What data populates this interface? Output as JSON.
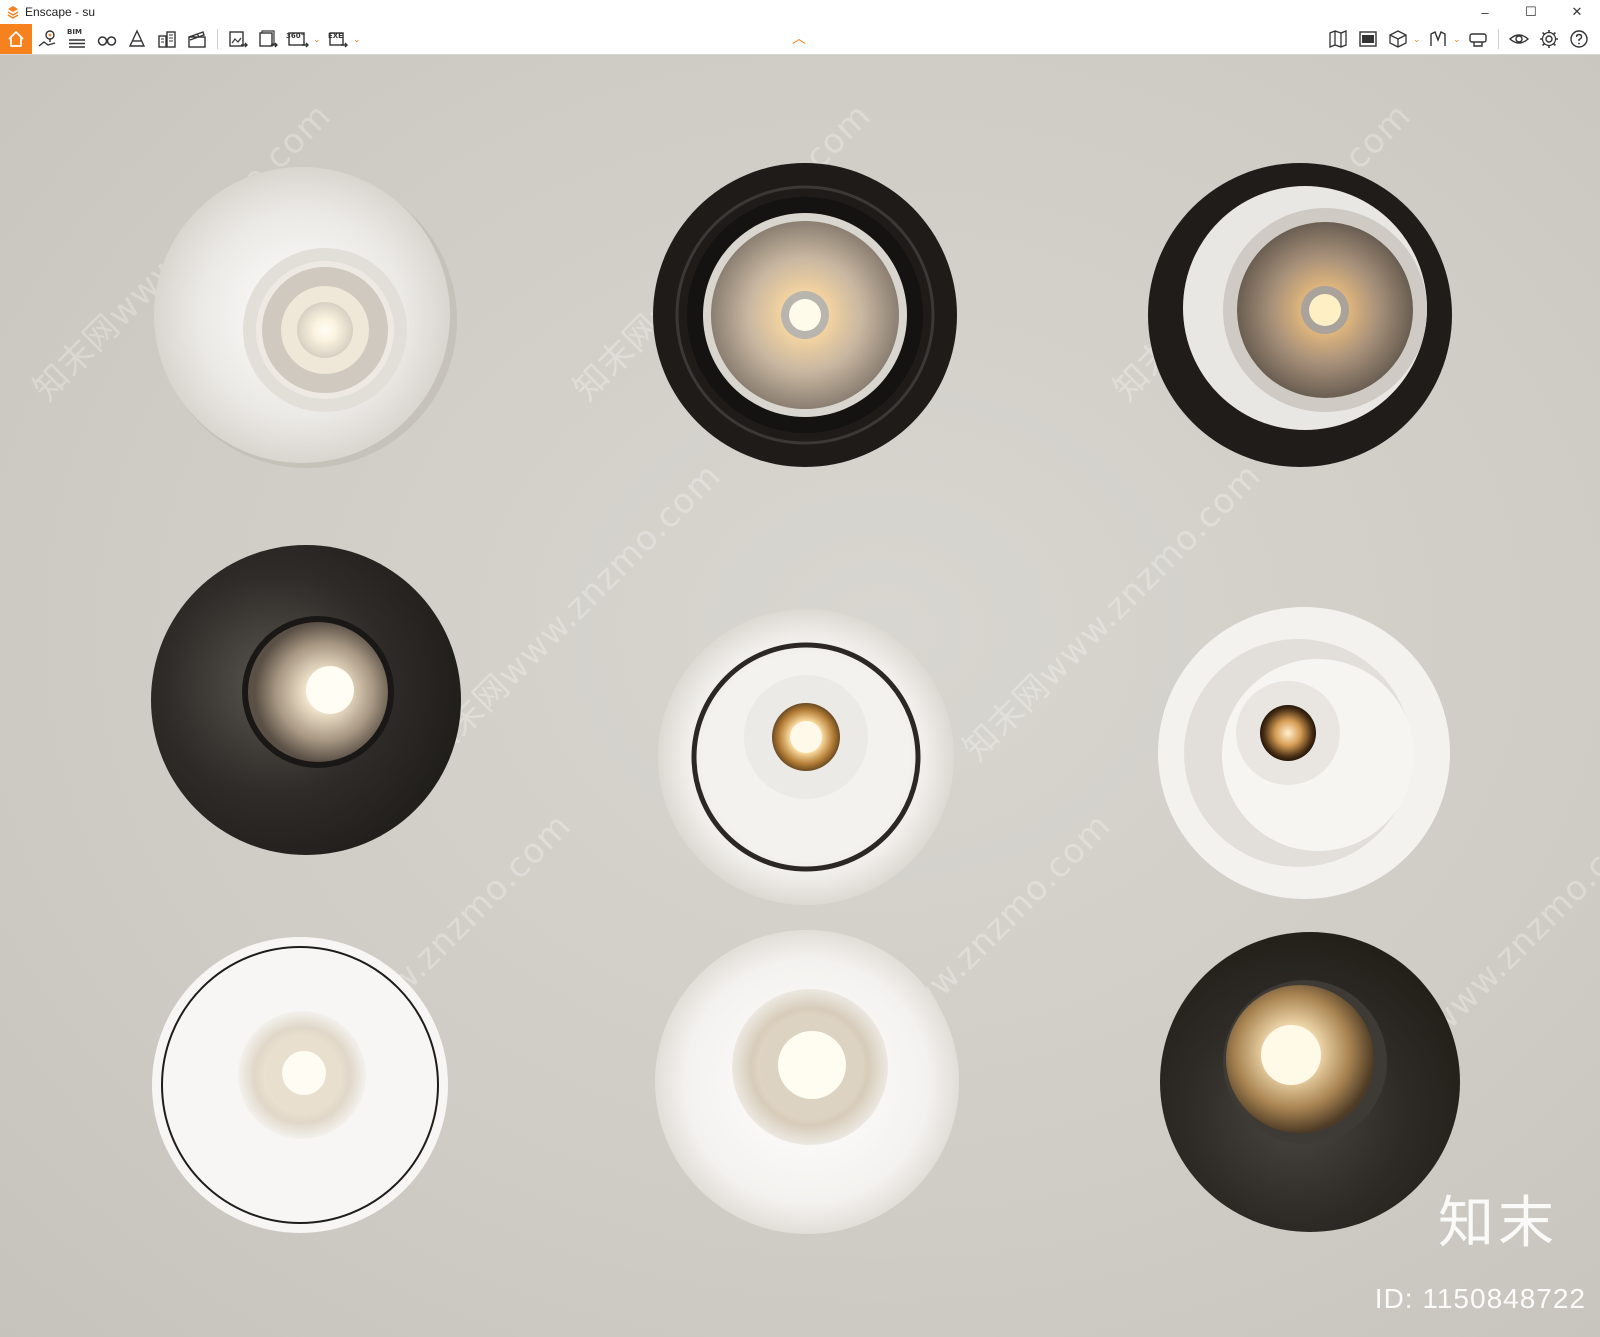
{
  "window": {
    "title": "Enscape - su",
    "controls": {
      "minimize": "–",
      "maximize": "☐",
      "close": "✕"
    }
  },
  "toolbar": {
    "left_tools": [
      {
        "name": "home-button",
        "icon": "home-icon"
      },
      {
        "name": "views-button",
        "icon": "location-pin-icon"
      },
      {
        "name": "bim-button",
        "icon": "bim-icon",
        "label": "BIM"
      },
      {
        "name": "walk-mode-button",
        "icon": "binoculars-icon"
      },
      {
        "name": "asset-library-button",
        "icon": "cone-icon"
      },
      {
        "name": "buildings-button",
        "icon": "buildings-icon"
      },
      {
        "name": "video-editor-button",
        "icon": "clapper-icon"
      },
      {
        "name": "screenshot-button",
        "icon": "export-image-icon"
      },
      {
        "name": "batch-render-button",
        "icon": "batch-export-icon"
      },
      {
        "name": "panorama-button",
        "icon": "panorama-icon",
        "label": "360°"
      },
      {
        "name": "exe-export-button",
        "icon": "exe-export-icon",
        "label": "EXE"
      }
    ],
    "right_tools": [
      {
        "name": "map-button",
        "icon": "map-icon"
      },
      {
        "name": "capture-button",
        "icon": "image-icon"
      },
      {
        "name": "cube-button",
        "icon": "cube-icon"
      },
      {
        "name": "materials-button",
        "icon": "materials-icon"
      },
      {
        "name": "vr-button",
        "icon": "vr-headset-icon"
      },
      {
        "name": "visual-settings-button",
        "icon": "eye-icon"
      },
      {
        "name": "settings-button",
        "icon": "gear-icon"
      },
      {
        "name": "help-button",
        "icon": "help-icon"
      }
    ],
    "accent_color": "#f5811f"
  },
  "viewport": {
    "watermark_text": "知末网www.znzmo.com",
    "brand_logo": "知末",
    "brand_id": "ID: 1150848722",
    "lights": [
      {
        "name": "light-white-trimmed",
        "housing": "#f2f1ee",
        "inner": "#e7e4df",
        "lens": "clear"
      },
      {
        "name": "light-black-gimbal",
        "housing": "#1e1b19",
        "inner": "#2b2826",
        "lens": "warm-reflector"
      },
      {
        "name": "light-black-tilted",
        "housing": "#1f1c1a",
        "inner": "#e8e6e2",
        "lens": "warm-reflector"
      },
      {
        "name": "light-dark-cone",
        "housing": "#2c2a27",
        "inner": "#3a3733",
        "lens": "honeycomb"
      },
      {
        "name": "light-white-ring",
        "housing": "#f4f3f0",
        "inner": "#f0eeea",
        "lens": "small-warm"
      },
      {
        "name": "light-white-tilted",
        "housing": "#f3f2ef",
        "inner": "#ebe9e5",
        "lens": "small-honeycomb"
      },
      {
        "name": "light-white-thin-ring",
        "housing": "#f7f6f4",
        "inner": "#eeecea",
        "lens": "clear"
      },
      {
        "name": "light-white-dome",
        "housing": "#f6f5f3",
        "inner": "#f0eeeb",
        "lens": "clear"
      },
      {
        "name": "light-dark-warm",
        "housing": "#2a2825",
        "inner": "#3a3632",
        "lens": "warm-clear"
      }
    ]
  }
}
